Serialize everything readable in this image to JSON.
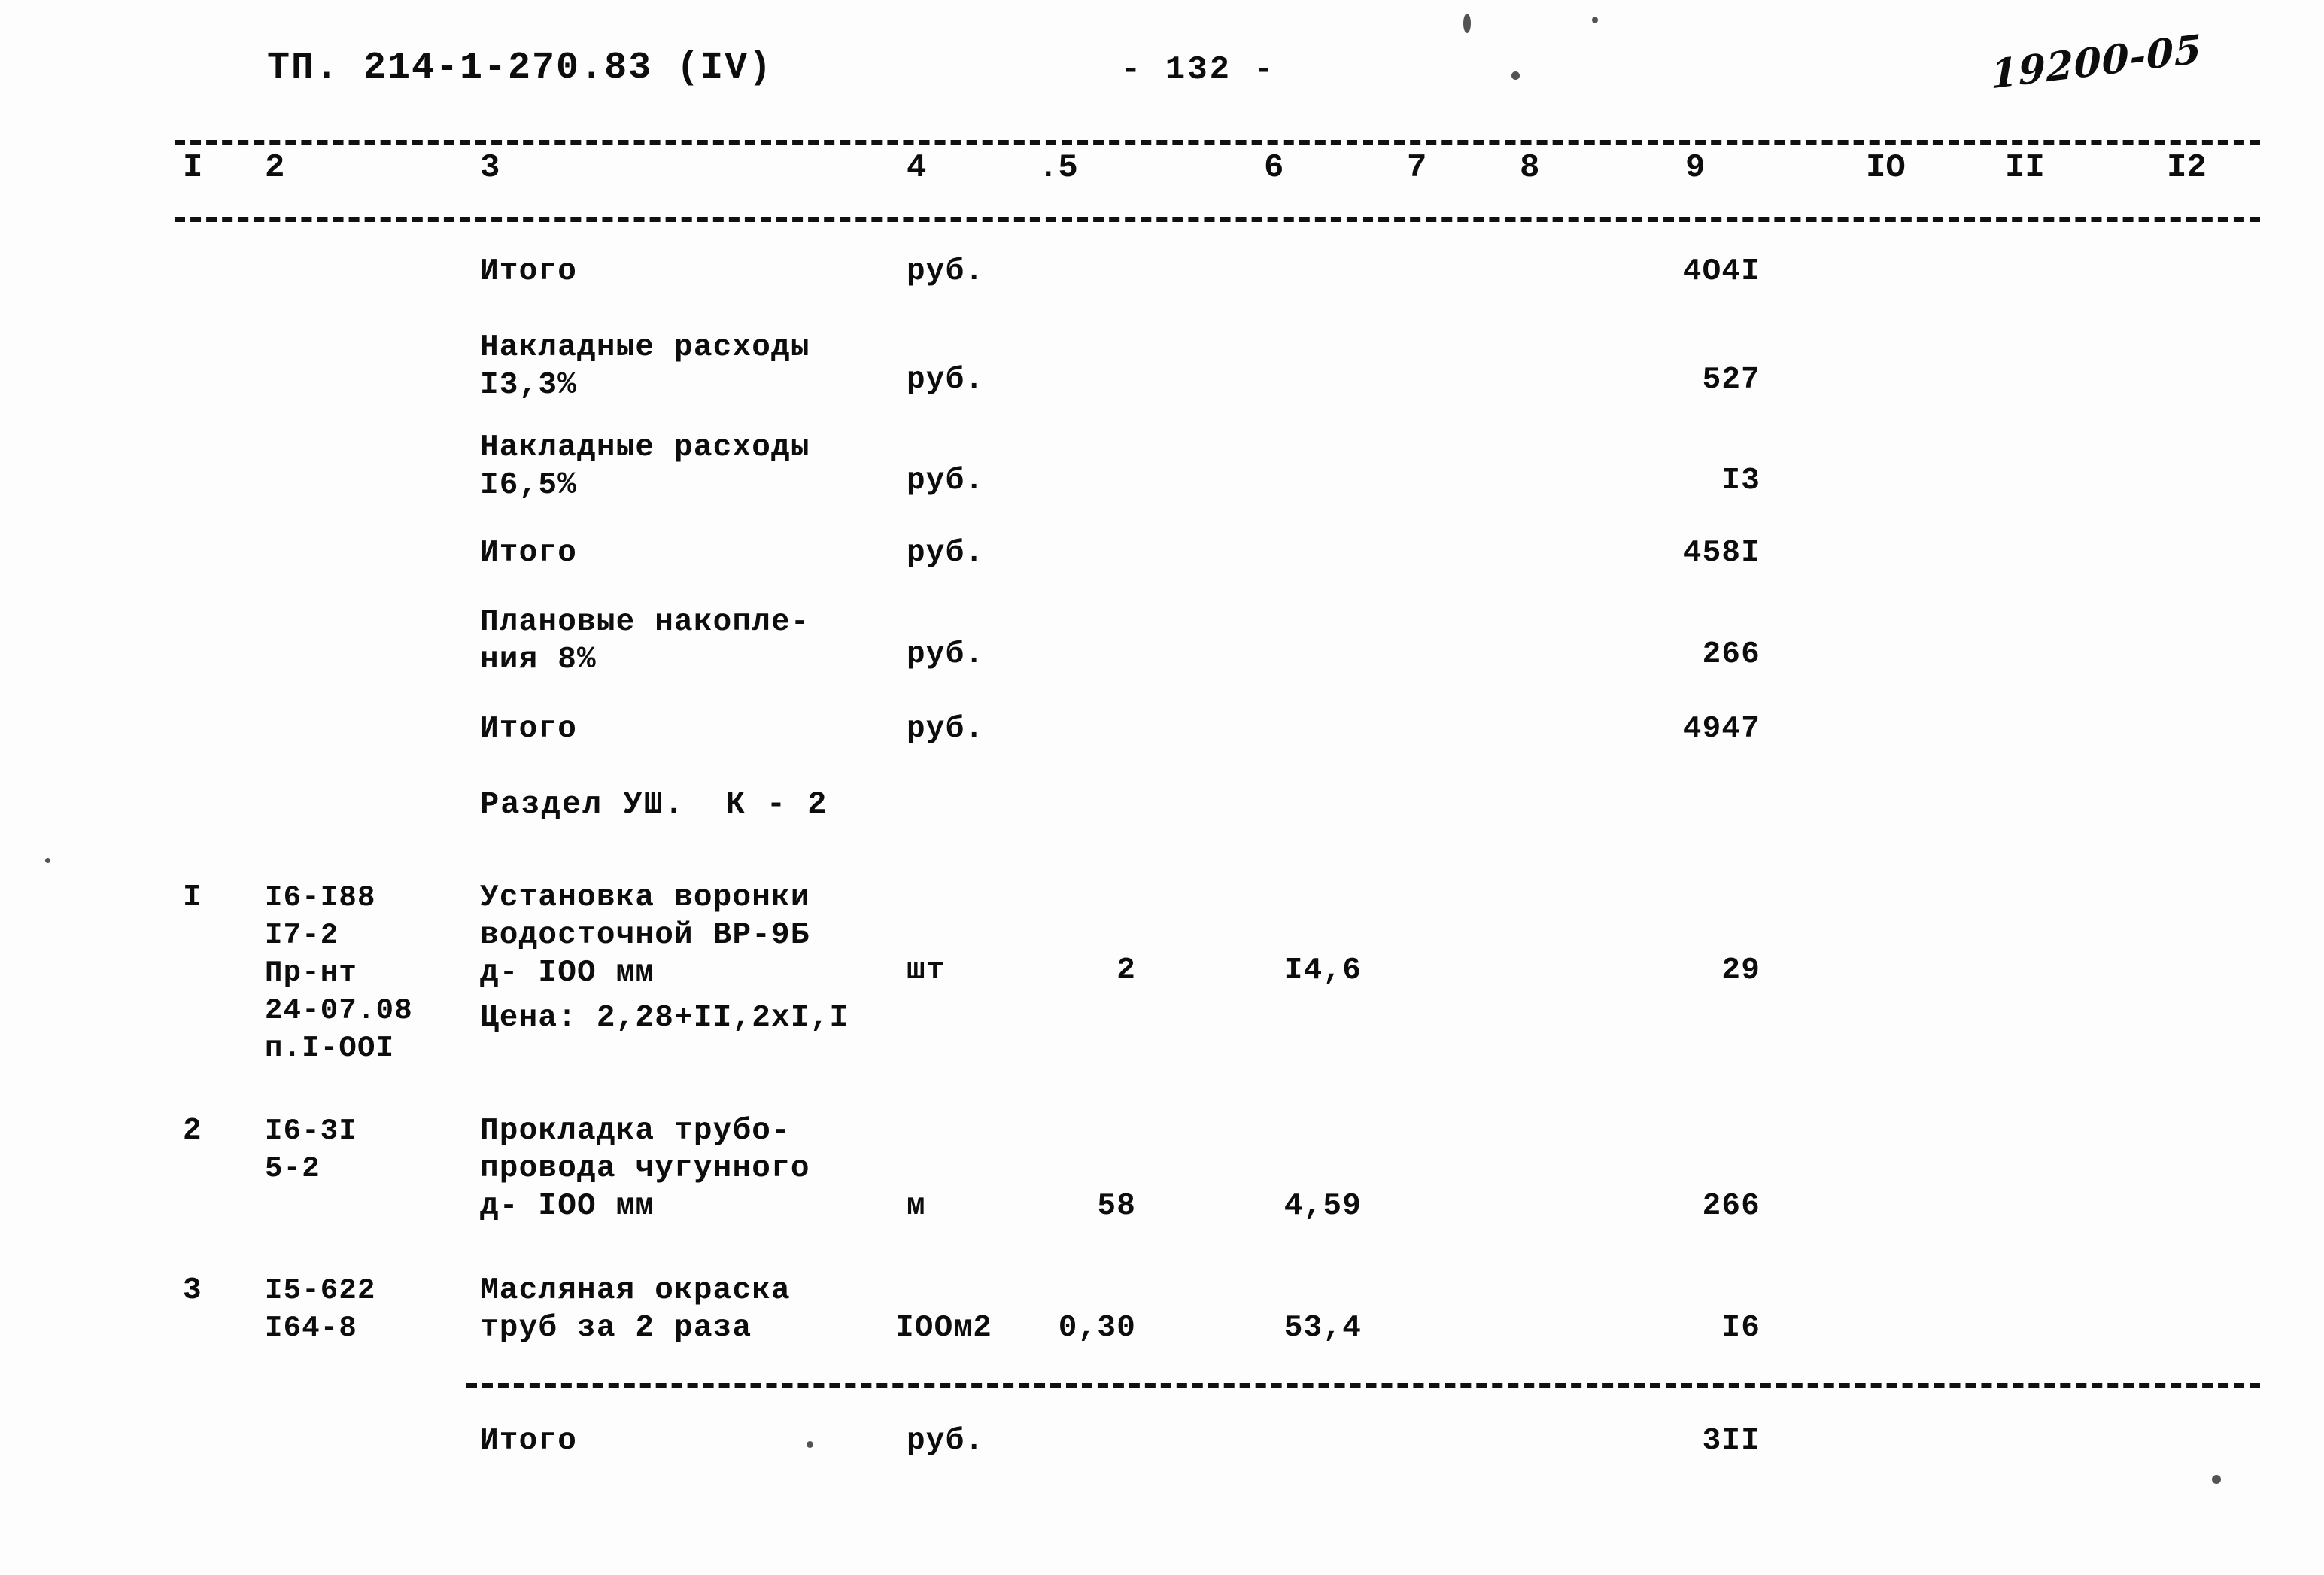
{
  "header": {
    "doc_code": "ТП. 214-1-270.83 (IV)",
    "page_number": "- 132 -",
    "hand_note": "19200-05"
  },
  "column_numbers": [
    "I",
    "2",
    "3",
    "4",
    ".5",
    "6",
    "7",
    "8",
    "9",
    "IO",
    "II",
    "I2"
  ],
  "rows": [
    {
      "no": "",
      "code": "",
      "name": "Итого",
      "unit": "руб.",
      "qty": "",
      "price": "",
      "total": "4O4I"
    },
    {
      "no": "",
      "code": "",
      "name": "Накладные расходы\nI3,3%",
      "unit": "руб.",
      "qty": "",
      "price": "",
      "total": "527"
    },
    {
      "no": "",
      "code": "",
      "name": "Накладные расходы\nI6,5%",
      "unit": "руб.",
      "qty": "",
      "price": "",
      "total": "I3"
    },
    {
      "no": "",
      "code": "",
      "name": "Итого",
      "unit": "руб.",
      "qty": "",
      "price": "",
      "total": "458I"
    },
    {
      "no": "",
      "code": "",
      "name": "Плановые накопле-\nния 8%",
      "unit": "руб.",
      "qty": "",
      "price": "",
      "total": "266"
    },
    {
      "no": "",
      "code": "",
      "name": "Итого",
      "unit": "руб.",
      "qty": "",
      "price": "",
      "total": "4947"
    }
  ],
  "section": {
    "title": "Раздел УШ.  К - 2"
  },
  "items": [
    {
      "no": "I",
      "code": "I6-I88\nI7-2\nПр-нт\n24-07.08\nп.I-OOI",
      "name": "Установка воронки\nводосточной ВР-9Б\nд- IОО мм",
      "note": "Цена: 2,28+II,2xI,I",
      "unit": "шт",
      "qty": "2",
      "price": "I4,6",
      "total": "29"
    },
    {
      "no": "2",
      "code": "I6-3I\n5-2",
      "name": "Прокладка трубо-\nпровода чугунного\nд- IОО мм",
      "note": "",
      "unit": "м",
      "qty": "58",
      "price": "4,59",
      "total": "266"
    },
    {
      "no": "3",
      "code": "I5-622\nI64-8",
      "name": "Масляная окраска\nтруб за 2 раза",
      "note": "",
      "unit": "IOOм2",
      "qty": "0,30",
      "price": "53,4",
      "total": "I6"
    }
  ],
  "footer_total": {
    "name": "Итого",
    "unit": "руб.",
    "total": "3II"
  }
}
